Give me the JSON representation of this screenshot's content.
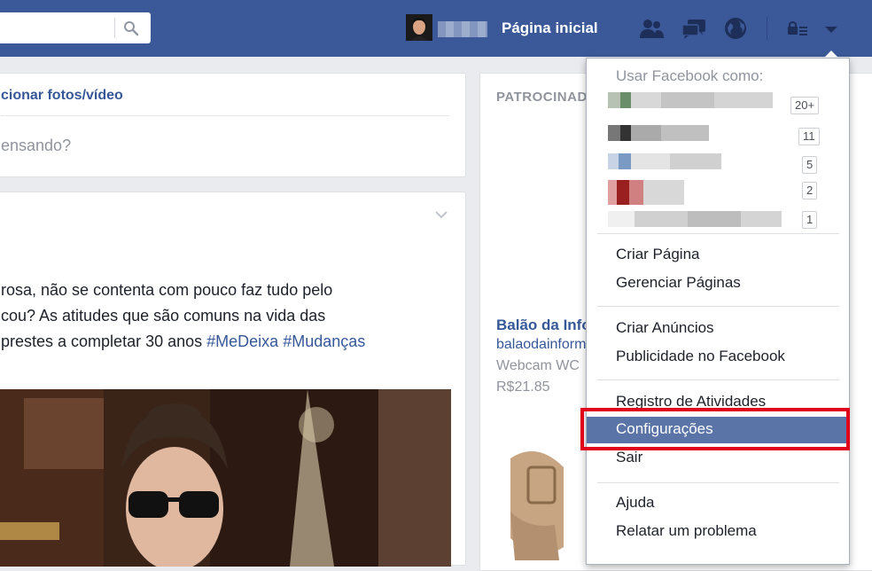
{
  "topbar": {
    "home_label": "Página inicial",
    "icons": [
      "search-icon",
      "friend-requests-icon",
      "messages-icon",
      "notifications-globe-icon",
      "privacy-lock-icon",
      "menu-caret-icon"
    ]
  },
  "composer": {
    "add_photos_label": "cionar fotos/vídeo",
    "placeholder": "ensando?"
  },
  "post": {
    "lines": [
      "rosa, não se contenta com pouco faz tudo pelo",
      "cou? As atitudes que são comuns na vida das"
    ],
    "line3_text": "prestes a completar 30 anos ",
    "hashtag1": "#MeDeixa",
    "hashtag2": "#Mudanças"
  },
  "sponsored": {
    "header": "PATROCINAD",
    "ad": {
      "title": "Balão da Info",
      "domain": "balaodainform",
      "description": "Webcam WC",
      "price": "R$21.85"
    }
  },
  "menu": {
    "header": "Usar Facebook como:",
    "accounts": [
      {
        "badge": "20+"
      },
      {
        "badge": "11"
      },
      {
        "badge": "5"
      },
      {
        "badge": "2"
      },
      {
        "badge": "1"
      }
    ],
    "group1": [
      "Criar Página",
      "Gerenciar Páginas"
    ],
    "group2": [
      "Criar Anúncios",
      "Publicidade no Facebook"
    ],
    "group3": [
      "Registro de Atividades",
      "Configurações",
      "Sair"
    ],
    "group4": [
      "Ajuda",
      "Relatar um problema"
    ]
  },
  "colors": {
    "brand_blue": "#3b5998",
    "highlight_red": "#e0001b",
    "active_item": "#5b74a8"
  }
}
